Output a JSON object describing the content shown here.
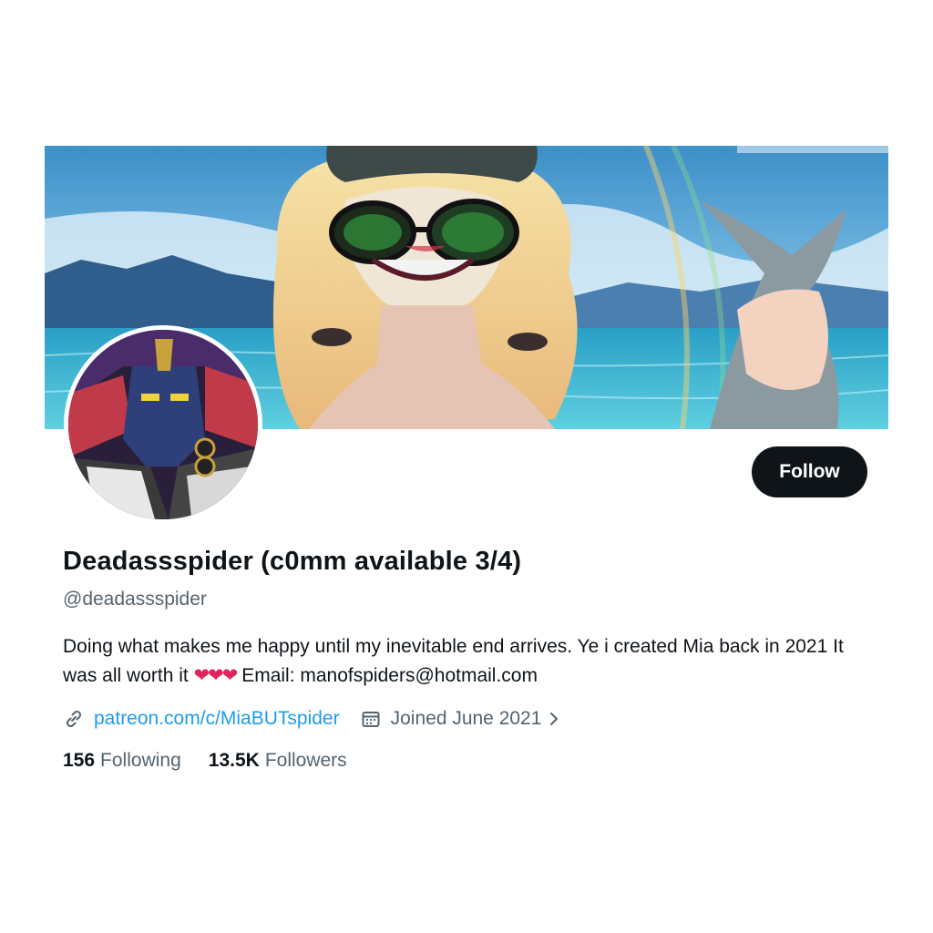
{
  "profile": {
    "display_name": "Deadassspider (c0mm available 3/4)",
    "handle": "@deadassspider",
    "bio_text": "Doing what makes me happy until my inevitable end arrives. Ye i created Mia back in 2021 It was all worth it",
    "bio_hearts": "❤❤❤",
    "bio_email": "Email: manofspiders@hotmail.com",
    "website": "patreon.com/c/MiaBUTspider",
    "joined": "Joined June 2021"
  },
  "actions": {
    "follow_label": "Follow"
  },
  "stats": {
    "following_count": "156",
    "following_label": "Following",
    "followers_count": "13.5K",
    "followers_label": "Followers"
  },
  "icons": {
    "website": "link-icon",
    "joined": "calendar-icon",
    "more": "chevron-right-icon"
  },
  "colors": {
    "text": "#0f1419",
    "secondary": "#536471",
    "link": "#1d9bf0",
    "follow_button": "#0f1419",
    "heart": "#e0245e"
  }
}
